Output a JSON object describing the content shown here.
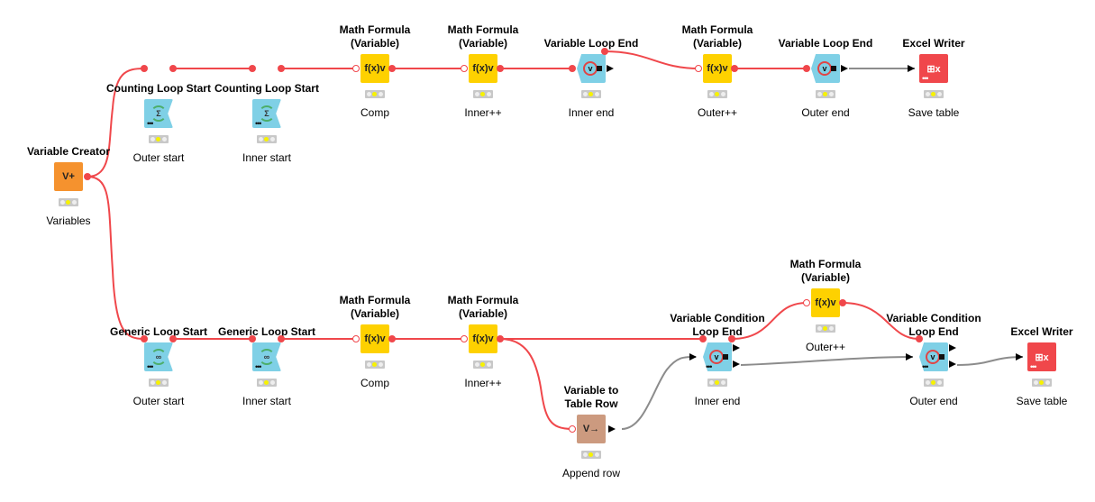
{
  "canvas": {
    "background": "#ffffff"
  },
  "colors": {
    "flow_variable_wire": "#f0474b",
    "data_wire": "#8c8c8c",
    "loop_node": "#7fd0e6",
    "manipulator_node": "#fed100",
    "other_node": "#f5922e",
    "sink_node": "#f0474b",
    "var_to_row_node": "#cc9a7f",
    "status_yellow": "#f7f200"
  },
  "nodes": [
    {
      "id": "n1",
      "title": "Variable Creator",
      "label": "Variables",
      "type": "other",
      "glyph": "V+",
      "icon": "variable-creator-icon"
    },
    {
      "id": "n2",
      "title": "Counting Loop Start",
      "label": "Outer start",
      "type": "loopstart",
      "glyph": "Σ",
      "icon": "counting-loop-icon"
    },
    {
      "id": "n3",
      "title": "Counting Loop Start",
      "label": "Inner start",
      "type": "loopstart",
      "glyph": "Σ",
      "icon": "counting-loop-icon"
    },
    {
      "id": "n4",
      "title": "Math Formula\n(Variable)",
      "label": "Comp",
      "type": "manip",
      "glyph": "f(x)v",
      "icon": "math-formula-icon"
    },
    {
      "id": "n5",
      "title": "Math Formula\n(Variable)",
      "label": "Inner++",
      "type": "manip",
      "glyph": "f(x)v",
      "icon": "math-formula-icon"
    },
    {
      "id": "n6",
      "title": "Variable Loop End",
      "label": "Inner end",
      "type": "loopend",
      "glyph": "v",
      "icon": "loop-end-icon"
    },
    {
      "id": "n7",
      "title": "Math Formula\n(Variable)",
      "label": "Outer++",
      "type": "manip",
      "glyph": "f(x)v",
      "icon": "math-formula-icon"
    },
    {
      "id": "n8",
      "title": "Variable Loop End",
      "label": "Outer end",
      "type": "loopend",
      "glyph": "v",
      "icon": "loop-end-icon"
    },
    {
      "id": "n9",
      "title": "Excel Writer",
      "label": "Save table",
      "type": "sink",
      "glyph": "⊞x",
      "icon": "excel-writer-icon"
    },
    {
      "id": "n10",
      "title": "Generic Loop Start",
      "label": "Outer start",
      "type": "loopstart",
      "glyph": "∞",
      "icon": "generic-loop-icon"
    },
    {
      "id": "n11",
      "title": "Generic Loop Start",
      "label": "Inner start",
      "type": "loopstart",
      "glyph": "∞",
      "icon": "generic-loop-icon"
    },
    {
      "id": "n12",
      "title": "Math Formula\n(Variable)",
      "label": "Comp",
      "type": "manip",
      "glyph": "f(x)v",
      "icon": "math-formula-icon"
    },
    {
      "id": "n13",
      "title": "Math Formula\n(Variable)",
      "label": "Inner++",
      "type": "manip",
      "glyph": "f(x)v",
      "icon": "math-formula-icon"
    },
    {
      "id": "n14",
      "title": "Variable to\nTable Row",
      "label": "Append row",
      "type": "v2row",
      "glyph": "V→",
      "icon": "variable-to-row-icon"
    },
    {
      "id": "n15",
      "title": "Variable Condition\nLoop End",
      "label": "Inner end",
      "type": "loopend",
      "glyph": "v",
      "icon": "condition-loop-end-icon"
    },
    {
      "id": "n16",
      "title": "Math Formula\n(Variable)",
      "label": "Outer++",
      "type": "manip",
      "glyph": "f(x)v",
      "icon": "math-formula-icon"
    },
    {
      "id": "n17",
      "title": "Variable Condition\nLoop End",
      "label": "Outer end",
      "type": "loopend",
      "glyph": "v",
      "icon": "condition-loop-end-icon"
    },
    {
      "id": "n18",
      "title": "Excel Writer",
      "label": "Save table",
      "type": "sink",
      "glyph": "⊞x",
      "icon": "excel-writer-icon"
    }
  ]
}
